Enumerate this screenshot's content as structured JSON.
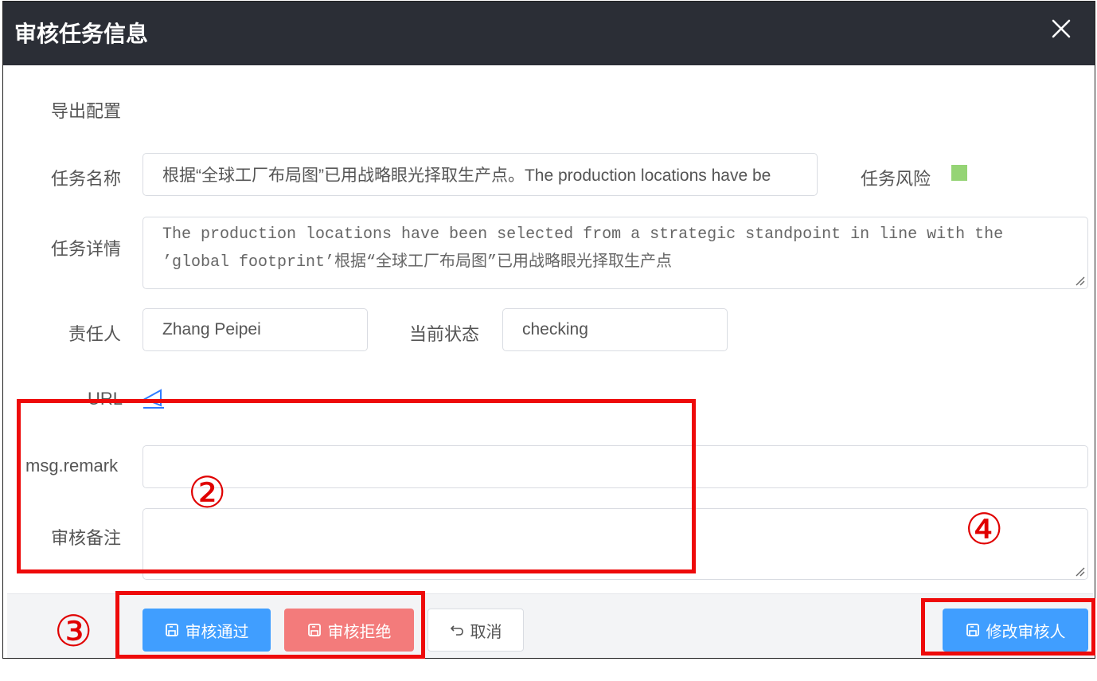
{
  "dialog": {
    "title": "审核任务信息",
    "close_icon": "close-icon"
  },
  "form": {
    "export_config_label": "导出配置",
    "task_name_label": "任务名称",
    "task_name_value": "根据“全球工厂布局图”已用战略眼光择取生产点。The production locations have be",
    "task_risk_label": "任务风险",
    "task_risk_color": "#95d475",
    "task_detail_label": "任务详情",
    "task_detail_line1": "The production locations have been selected from a strategic standpoint in line with the",
    "task_detail_line2": "’global footprint’根据“全球工厂布局图”已用战略眼光择取生产点",
    "owner_label": "责任人",
    "owner_value": "Zhang Peipei",
    "status_label": "当前状态",
    "status_value": "checking",
    "url_label": "URL",
    "remark_label": "msg.remark",
    "remark_value": "",
    "review_note_label": "审核备注",
    "review_note_value": ""
  },
  "footer": {
    "approve_label": "审核通过",
    "reject_label": "审核拒绝",
    "cancel_label": "取消",
    "change_reviewer_label": "修改审核人"
  },
  "annotations": {
    "marker_2": "②",
    "marker_3": "③",
    "marker_4": "④",
    "highlight_color": "#ee0a0a"
  }
}
